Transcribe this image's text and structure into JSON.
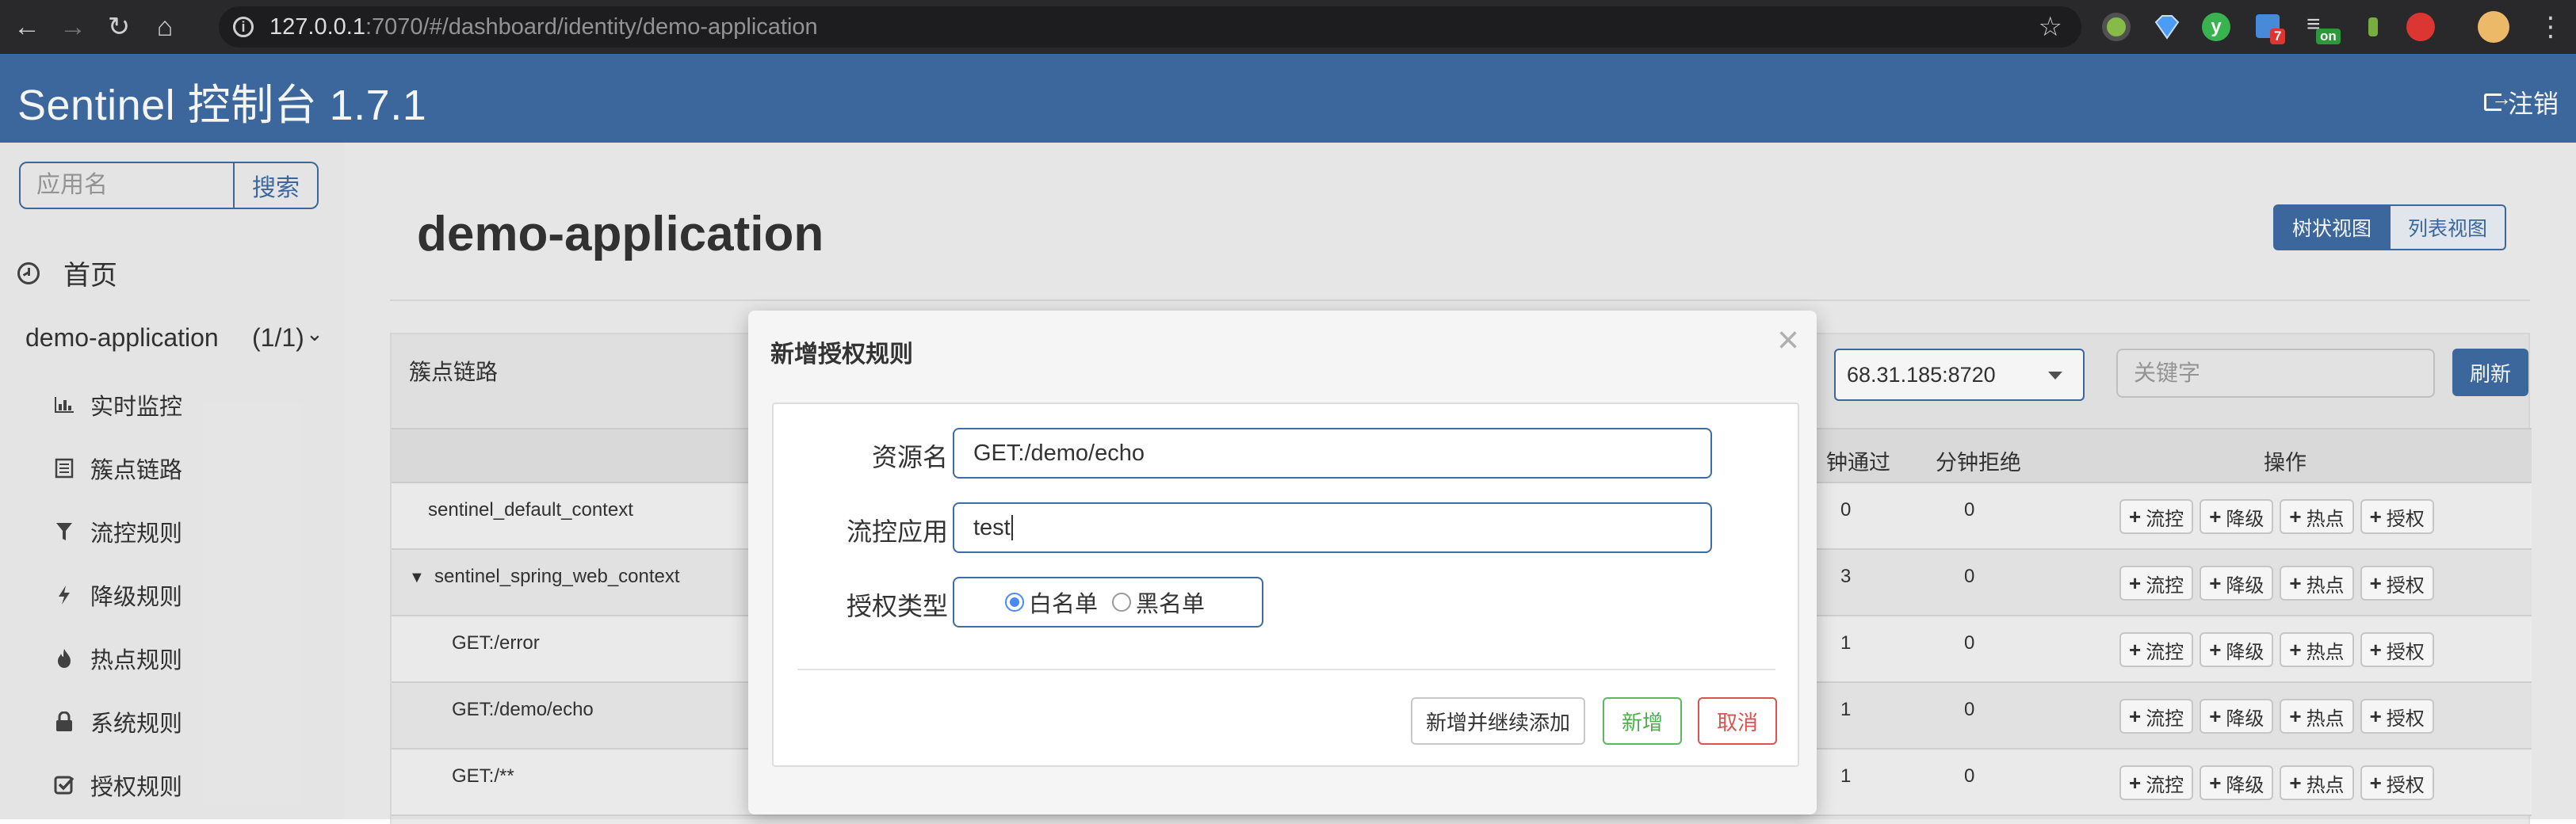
{
  "browser": {
    "url_host": "127.0.0.1",
    "url_rest": ":7070/#/dashboard/identity/demo-application",
    "extensions": [
      {
        "name": "green-dot-extension-icon",
        "color": "#8cc34a"
      },
      {
        "name": "diamond-extension-icon",
        "color": "#4ea3ff"
      },
      {
        "name": "y-extension-icon",
        "color": "#3cba54"
      },
      {
        "name": "grid-extension-icon",
        "color": "#4a90e2",
        "badge": "7"
      },
      {
        "name": "list-extension-icon",
        "color": "#666666",
        "badge": "on"
      },
      {
        "name": "leaf-extension-icon",
        "color": "#7cb342"
      },
      {
        "name": "red-extension-icon",
        "color": "#e53935"
      },
      {
        "name": "avatar-extension-icon",
        "color": "#f5c16c"
      }
    ]
  },
  "header": {
    "brand": "Sentinel 控制台 1.7.1",
    "logout": "注销"
  },
  "sidebar": {
    "search_placeholder": "应用名",
    "search_button": "搜索",
    "home": "首页",
    "app_name": "demo-application",
    "app_count": "(1/1)",
    "items": [
      {
        "label": "实时监控",
        "icon": "bar-chart-icon"
      },
      {
        "label": "簇点链路",
        "icon": "list-icon"
      },
      {
        "label": "流控规则",
        "icon": "filter-icon"
      },
      {
        "label": "降级规则",
        "icon": "bolt-icon"
      },
      {
        "label": "热点规则",
        "icon": "fire-icon"
      },
      {
        "label": "系统规则",
        "icon": "lock-icon"
      },
      {
        "label": "授权规则",
        "icon": "check-icon"
      }
    ]
  },
  "main": {
    "title": "demo-application",
    "view_tree": "树状视图",
    "view_list": "列表视图",
    "card_title": "簇点链路",
    "machine": "68.31.185:8720",
    "keyword_placeholder": "关键字",
    "refresh": "刷新",
    "columns": {
      "pass": "钟通过",
      "block": "分钟拒绝",
      "ops": "操作"
    },
    "rows": [
      {
        "name": "sentinel_default_context",
        "pass": "0",
        "block": "0"
      },
      {
        "name": "sentinel_spring_web_context",
        "pass": "3",
        "block": "0"
      },
      {
        "name": "GET:/error",
        "pass": "1",
        "block": "0"
      },
      {
        "name": "GET:/demo/echo",
        "pass": "1",
        "block": "0"
      },
      {
        "name": "GET:/**",
        "pass": "1",
        "block": "0"
      }
    ],
    "row_toggle": "▼",
    "op_buttons": [
      "流控",
      "降级",
      "热点",
      "授权"
    ]
  },
  "modal": {
    "title": "新增授权规则",
    "close": "×",
    "resource_label": "资源名",
    "resource_value": "GET:/demo/echo",
    "limit_app_label": "流控应用",
    "limit_app_value": "test",
    "strategy_label": "授权类型",
    "whitelist": "白名单",
    "blacklist": "黑名单",
    "btn_add_continue": "新增并继续添加",
    "btn_add": "新增",
    "btn_cancel": "取消"
  }
}
